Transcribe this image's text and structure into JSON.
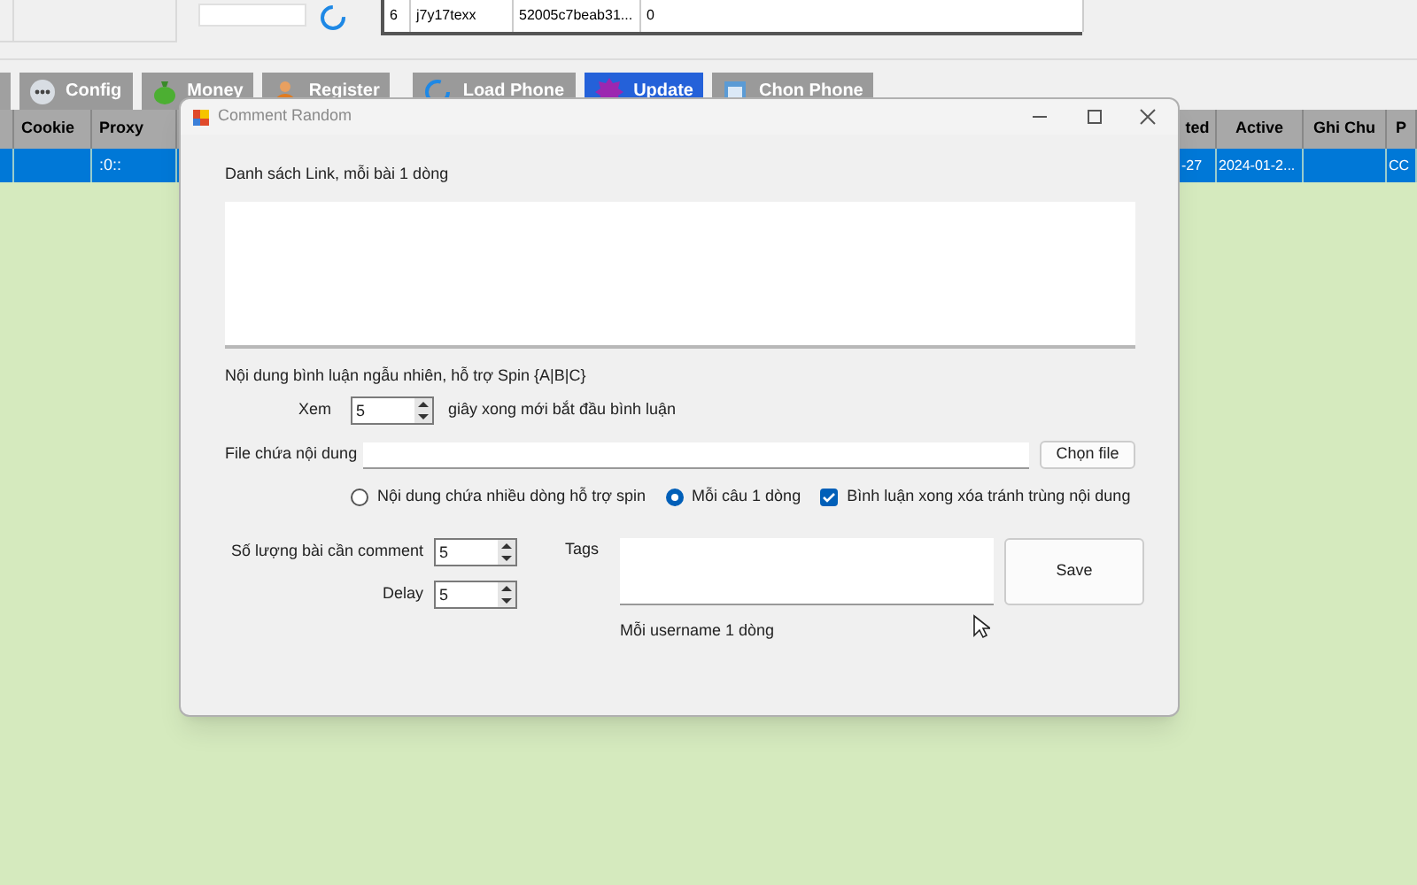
{
  "main_window": {
    "top_table": {
      "rows": [
        {
          "cells": [
            "6",
            "j7y17texx",
            "52005c7beab31...",
            "0"
          ]
        }
      ]
    },
    "toolbar": [
      {
        "kind": "config",
        "label": "Config"
      },
      {
        "kind": "money",
        "label": "Money"
      },
      {
        "kind": "register",
        "label": "Register"
      },
      {
        "kind": "load",
        "label": "Load Phone"
      },
      {
        "kind": "update",
        "label": "Update",
        "selected": true
      },
      {
        "kind": "choose",
        "label": "Chon Phone"
      }
    ],
    "grid": {
      "row_selected": true,
      "left_columns": [
        {
          "header": "Cookie"
        },
        {
          "header": "Proxy",
          "cell": ":0::"
        }
      ],
      "right_columns": [
        {
          "header": "ted",
          "cell": "-27"
        },
        {
          "header": "Active",
          "cell": "2024-01-2..."
        },
        {
          "header": "Ghi Chu"
        },
        {
          "header": "P",
          "cell": "CC"
        }
      ]
    }
  },
  "dialog": {
    "title": "Comment Random",
    "link_label": "Danh sách Link, mỗi bài 1 dòng",
    "content_label": "Nội dung bình luận ngẫu nhiên, hỗ trợ Spin {A|B|C}",
    "view_label": "Xem",
    "view_value": "5",
    "view_suffix": "giây xong mới bắt đầu bình luận",
    "file_label": "File chứa nội dung",
    "file_button": "Chọn file",
    "options": [
      {
        "kind": "radio",
        "label": "Nội dung chứa nhiều dòng hỗ trợ spin",
        "selected": false
      },
      {
        "kind": "radio",
        "label": "Mỗi câu 1 dòng",
        "selected": true
      },
      {
        "kind": "checkbox",
        "label": "Bình luận xong xóa tránh trùng nội dung",
        "checked": true
      }
    ],
    "count_label": "Số lượng bài cần comment",
    "count_value": "5",
    "delay_label": "Delay",
    "delay_value": "5",
    "tags_label": "Tags",
    "save_button": "Save",
    "tags_hint": "Mỗi username 1 dòng"
  }
}
